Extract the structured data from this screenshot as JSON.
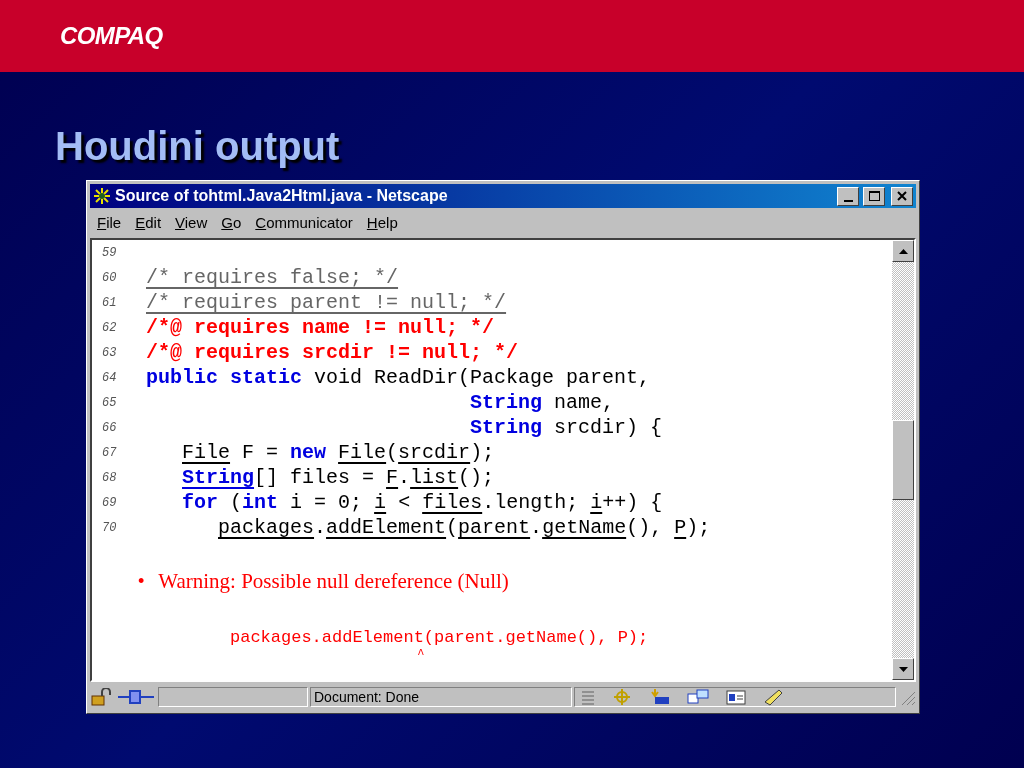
{
  "slide": {
    "logo": "COMPAQ",
    "title": "Houdini output"
  },
  "window": {
    "title": "Source of tohtml.Java2Html.java - Netscape",
    "menu": [
      {
        "mnemonic": "F",
        "rest": "ile"
      },
      {
        "mnemonic": "E",
        "rest": "dit"
      },
      {
        "mnemonic": "V",
        "rest": "iew"
      },
      {
        "mnemonic": "G",
        "rest": "o"
      },
      {
        "mnemonic": "C",
        "rest": "ommunicator"
      },
      {
        "mnemonic": "H",
        "rest": "elp"
      }
    ],
    "code_lines": [
      {
        "number": "59"
      },
      {
        "number": "60",
        "tokens": [
          {
            "text": "/* requires false; */",
            "kind": "comment",
            "underlined": true
          }
        ]
      },
      {
        "number": "61",
        "tokens": [
          {
            "text": "/* requires parent != null; */",
            "kind": "comment",
            "underlined": true
          }
        ]
      },
      {
        "number": "62",
        "tokens": [
          {
            "text": "/*@ requires name != null; */",
            "kind": "annotation",
            "underlined": false
          }
        ]
      },
      {
        "number": "63",
        "tokens": [
          {
            "text": "/*@ requires srcdir != null; */",
            "kind": "annotation",
            "underlined": false
          }
        ]
      },
      {
        "number": "64",
        "tokens": [
          {
            "text": "public static",
            "kind": "keyword",
            "underlined": false
          },
          {
            "text": " void ReadDir(Package parent,",
            "kind": "plain",
            "underlined": false
          }
        ]
      },
      {
        "number": "65",
        "tokens": [
          {
            "text": "                           String",
            "kind": "keyword",
            "underlined": false
          },
          {
            "text": " name,",
            "kind": "plain",
            "underlined": false
          }
        ]
      },
      {
        "number": "66",
        "tokens": [
          {
            "text": "                           String",
            "kind": "keyword",
            "underlined": false
          },
          {
            "text": " srcdir) {",
            "kind": "plain",
            "underlined": false
          }
        ]
      },
      {
        "number": "67",
        "tokens": [
          {
            "text": "   File",
            "kind": "plain",
            "underlined": true
          },
          {
            "text": " F = ",
            "kind": "plain",
            "underlined": false
          },
          {
            "text": "new ",
            "kind": "keyword",
            "underlined": false
          },
          {
            "text": "File",
            "kind": "plain",
            "underlined": true
          },
          {
            "text": "(",
            "kind": "plain",
            "underlined": false
          },
          {
            "text": "srcdir",
            "kind": "plain",
            "underlined": true
          },
          {
            "text": ");",
            "kind": "plain",
            "underlined": false
          }
        ]
      },
      {
        "number": "68",
        "tokens": [
          {
            "text": "   String",
            "kind": "keyword",
            "underlined": true
          },
          {
            "text": "[] files = ",
            "kind": "plain",
            "underlined": false
          },
          {
            "text": "F",
            "kind": "plain",
            "underlined": true
          },
          {
            "text": ".",
            "kind": "plain",
            "underlined": false
          },
          {
            "text": "list",
            "kind": "plain",
            "underlined": true
          },
          {
            "text": "();",
            "kind": "plain",
            "underlined": false
          }
        ]
      },
      {
        "number": "69",
        "tokens": [
          {
            "text": "   for",
            "kind": "keyword",
            "underlined": false
          },
          {
            "text": " (",
            "kind": "plain",
            "underlined": false
          },
          {
            "text": "int",
            "kind": "keyword",
            "underlined": false
          },
          {
            "text": " i = 0; ",
            "kind": "plain",
            "underlined": false
          },
          {
            "text": "i",
            "kind": "plain",
            "underlined": true
          },
          {
            "text": " < ",
            "kind": "plain",
            "underlined": false
          },
          {
            "text": "files",
            "kind": "plain",
            "underlined": true
          },
          {
            "text": ".length; ",
            "kind": "plain",
            "underlined": false
          },
          {
            "text": "i",
            "kind": "plain",
            "underlined": true
          },
          {
            "text": "++) {",
            "kind": "plain",
            "underlined": false
          }
        ]
      },
      {
        "number": "70",
        "tokens": [
          {
            "text": "      packages",
            "kind": "plain",
            "underlined": true
          },
          {
            "text": ".",
            "kind": "plain",
            "underlined": false
          },
          {
            "text": "addElement",
            "kind": "plain",
            "underlined": true
          },
          {
            "text": "(",
            "kind": "plain",
            "underlined": false
          },
          {
            "text": "parent",
            "kind": "plain",
            "underlined": true
          },
          {
            "text": ".",
            "kind": "plain",
            "underlined": false
          },
          {
            "text": "getName",
            "kind": "plain",
            "underlined": true
          },
          {
            "text": "(), ",
            "kind": "plain",
            "underlined": false
          },
          {
            "text": "P",
            "kind": "plain",
            "underlined": true
          },
          {
            "text": ");",
            "kind": "plain",
            "underlined": false
          }
        ]
      }
    ],
    "warning": {
      "bullet": "•",
      "message": "Warning: Possible null dereference (Null)",
      "code": "packages.addElement(parent.getName(), P);",
      "caret": "                          ^"
    },
    "status_bar": {
      "text": "Document: Done"
    }
  }
}
